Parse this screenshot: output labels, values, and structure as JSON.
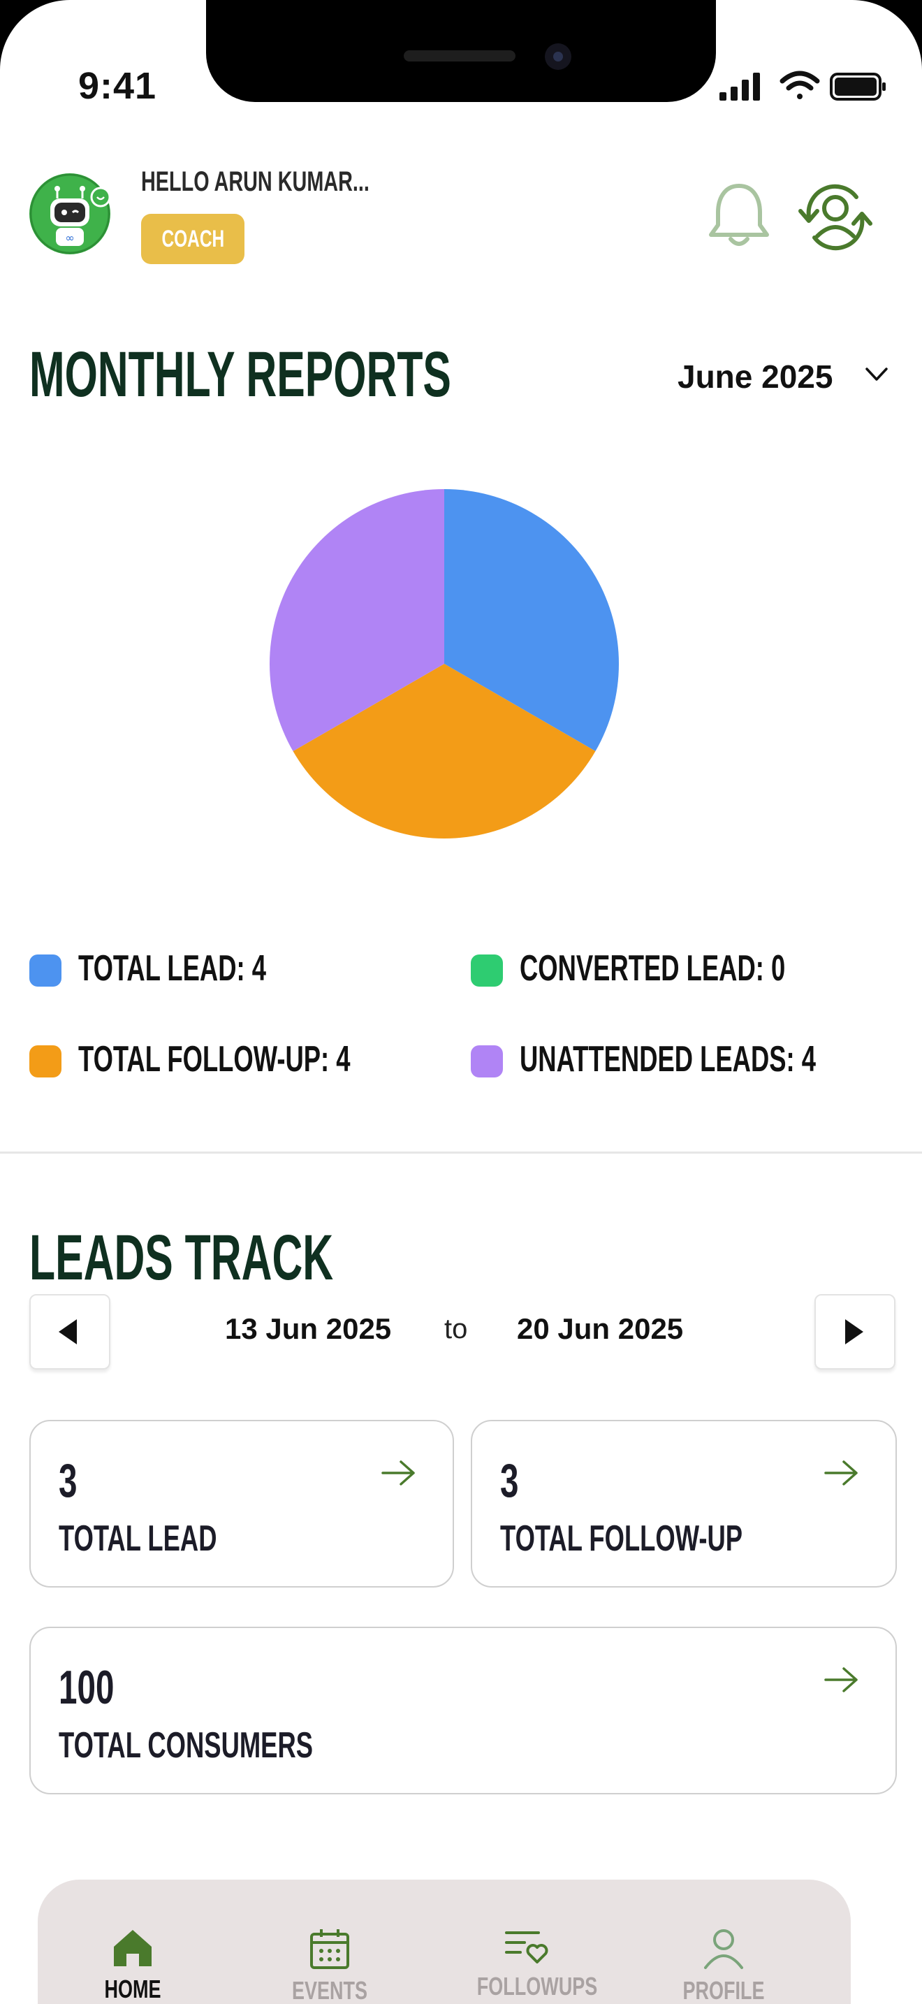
{
  "status_bar": {
    "time": "9:41"
  },
  "header": {
    "greeting": "HELLO ARUN KUMAR...",
    "role_badge": "COACH",
    "icons": [
      "bell-icon",
      "switch-user-icon"
    ]
  },
  "monthly_reports": {
    "title": "MONTHLY REPORTS",
    "selected_month": "June 2025"
  },
  "chart_data": {
    "type": "pie",
    "title": "",
    "slices": [
      {
        "name": "TOTAL LEAD",
        "value": 4,
        "color": "#4d93f0"
      },
      {
        "name": "TOTAL FOLLOW-UP",
        "value": 4,
        "color": "#f39c17"
      },
      {
        "name": "UNATTENDED LEADS",
        "value": 4,
        "color": "#b084f5"
      },
      {
        "name": "CONVERTED LEAD",
        "value": 0,
        "color": "#2ecc71"
      }
    ]
  },
  "legend": [
    {
      "label": "TOTAL LEAD: 4",
      "color": "#4d93f0"
    },
    {
      "label": "CONVERTED LEAD: 0",
      "color": "#2ecc71"
    },
    {
      "label": "TOTAL FOLLOW-UP: 4",
      "color": "#f39c17"
    },
    {
      "label": "UNATTENDED LEADS: 4",
      "color": "#b084f5"
    }
  ],
  "leads_track": {
    "title": "LEADS TRACK",
    "start_date": "13 Jun 2025",
    "separator": "to",
    "end_date": "20 Jun 2025",
    "cards": [
      {
        "value": "3",
        "label": "TOTAL LEAD"
      },
      {
        "value": "3",
        "label": "TOTAL FOLLOW-UP"
      },
      {
        "value": "100",
        "label": "TOTAL CONSUMERS"
      }
    ]
  },
  "bottom_nav": {
    "tabs": [
      {
        "label": "HOME",
        "icon": "home-icon",
        "active": true
      },
      {
        "label": "EVENTS",
        "icon": "calendar-icon",
        "active": false
      },
      {
        "label": "FOLLOWUPS",
        "icon": "followups-icon",
        "active": false
      },
      {
        "label": "PROFILE",
        "icon": "profile-icon",
        "active": false
      }
    ]
  },
  "colors": {
    "accent": "#4a7a2c",
    "heading": "#0f3020",
    "badge": "#e9be49"
  }
}
